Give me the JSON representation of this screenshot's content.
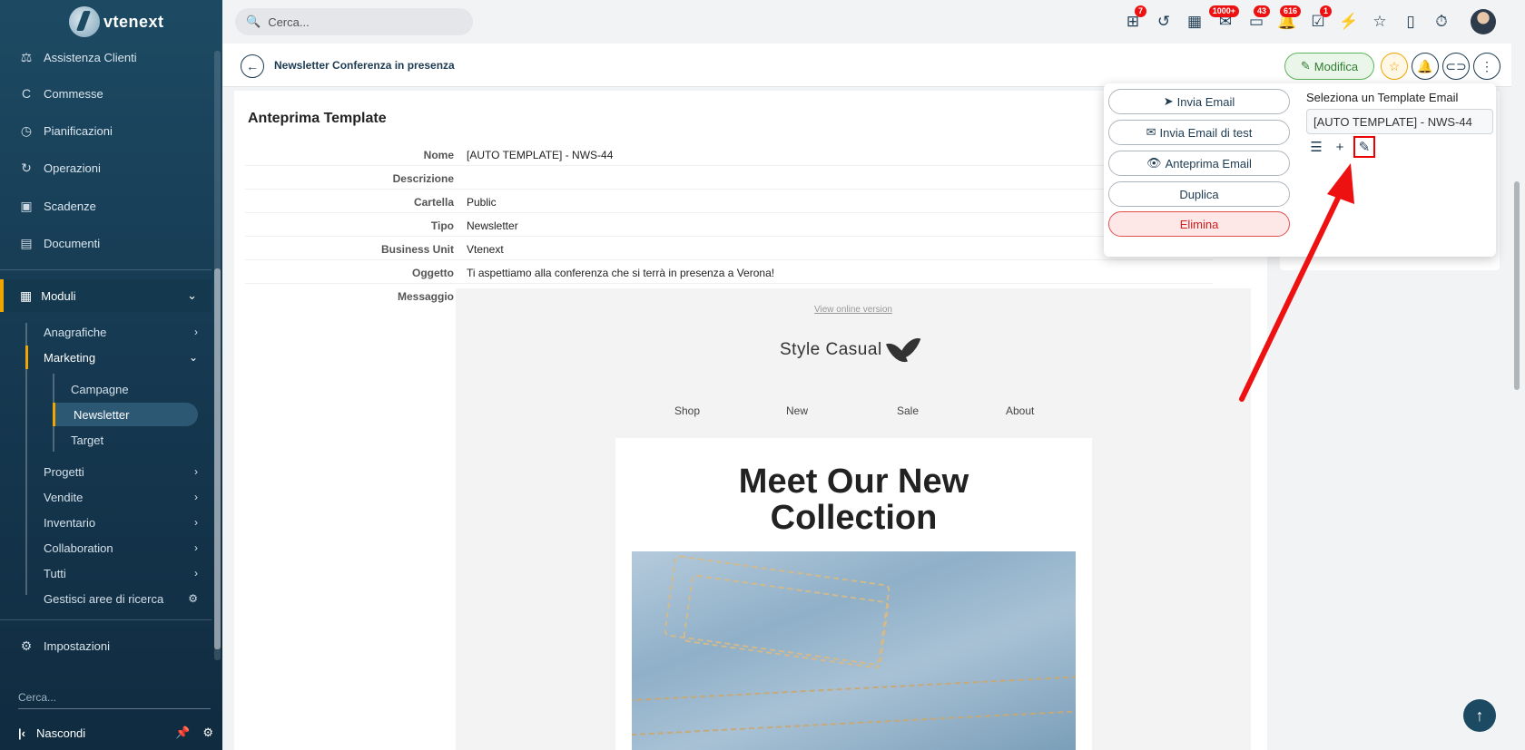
{
  "app": {
    "name": "vtenext"
  },
  "sidebar": {
    "items": [
      {
        "label": "Assistenza Clienti",
        "icon": "scale-icon"
      },
      {
        "label": "Commesse",
        "icon": "c-icon"
      },
      {
        "label": "Pianificazioni",
        "icon": "clock-icon"
      },
      {
        "label": "Operazioni",
        "icon": "refresh-icon"
      },
      {
        "label": "Scadenze",
        "icon": "calendar-x-icon"
      },
      {
        "label": "Documenti",
        "icon": "folder-icon"
      }
    ],
    "moduli_label": "Moduli",
    "submenu": [
      {
        "label": "Anagrafiche"
      },
      {
        "label": "Marketing"
      },
      {
        "label": "Progetti"
      },
      {
        "label": "Vendite"
      },
      {
        "label": "Inventario"
      },
      {
        "label": "Collaboration"
      },
      {
        "label": "Tutti"
      },
      {
        "label": "Gestisci aree di ricerca"
      }
    ],
    "marketing_children": [
      "Campagne",
      "Newsletter",
      "Target"
    ],
    "settings_label": "Impostazioni",
    "search_placeholder": "Cerca...",
    "hide_label": "Nascondi"
  },
  "topbar": {
    "search_placeholder": "Cerca...",
    "badges": {
      "hierarchy": "7",
      "mail": "1000+",
      "chat": "43",
      "bell": "616",
      "tasks": "1"
    }
  },
  "header": {
    "record_title": "Newsletter Conferenza in presenza",
    "edit_label": "Modifica"
  },
  "detail": {
    "section_title": "Anteprima Template",
    "fields": [
      {
        "label": "Nome",
        "value": "[AUTO TEMPLATE] - NWS-44"
      },
      {
        "label": "Descrizione",
        "value": ""
      },
      {
        "label": "Cartella",
        "value": "Public"
      },
      {
        "label": "Tipo",
        "value": "Newsletter"
      },
      {
        "label": "Business Unit",
        "value": "Vtenext"
      },
      {
        "label": "Oggetto",
        "value": "Ti aspettiamo alla conferenza che si terrà in presenza a Verona!"
      },
      {
        "label": "Messaggio",
        "value": ""
      }
    ]
  },
  "email": {
    "view_online": "View online version",
    "brand": "Style Casual",
    "nav": [
      "Shop",
      "New",
      "Sale",
      "About"
    ],
    "headline_1": "Meet Our New",
    "headline_2": "Collection"
  },
  "popup": {
    "send_email": "Invia Email",
    "send_test": "Invia Email di test",
    "preview_email": "Anteprima Email",
    "duplicate": "Duplica",
    "delete": "Elimina",
    "template_label": "Seleziona un Template Email",
    "template_value": "[AUTO TEMPLATE] - NWS-44"
  },
  "colors": {
    "accent": "#f0a500",
    "sidebar": "#1d4a63",
    "danger": "#e00000"
  }
}
